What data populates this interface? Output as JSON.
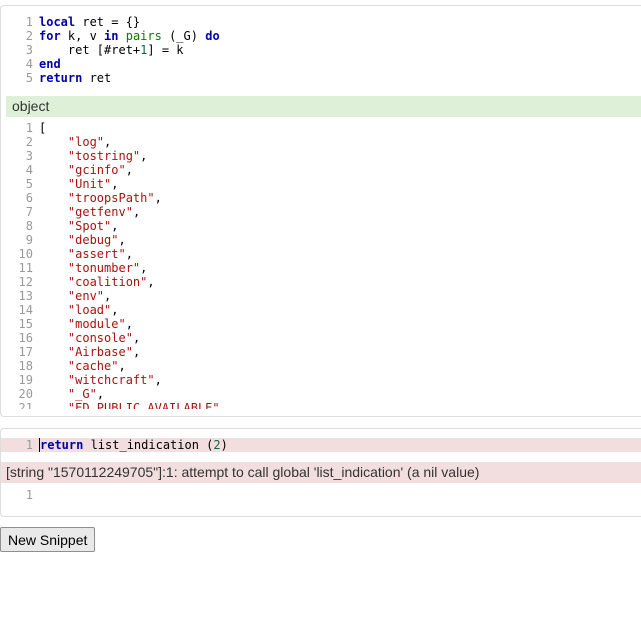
{
  "snippet1": {
    "input_lines": [
      {
        "n": "1",
        "tokens": [
          {
            "t": "local",
            "c": "kw"
          },
          {
            "t": " ret = {}"
          }
        ]
      },
      {
        "n": "2",
        "tokens": [
          {
            "t": "for",
            "c": "kw"
          },
          {
            "t": " k, v "
          },
          {
            "t": "in",
            "c": "kw"
          },
          {
            "t": " "
          },
          {
            "t": "pairs",
            "c": "bi"
          },
          {
            "t": " (_G) "
          },
          {
            "t": "do",
            "c": "kw"
          }
        ]
      },
      {
        "n": "3",
        "tokens": [
          {
            "t": "    ret [#ret+"
          },
          {
            "t": "1",
            "c": "num"
          },
          {
            "t": "] = k"
          }
        ]
      },
      {
        "n": "4",
        "tokens": [
          {
            "t": "end",
            "c": "kw"
          }
        ]
      },
      {
        "n": "5",
        "tokens": [
          {
            "t": "return",
            "c": "kw"
          },
          {
            "t": " ret"
          }
        ]
      }
    ],
    "output_type": "object",
    "output_lines": [
      {
        "n": "1",
        "text": "["
      },
      {
        "n": "2",
        "str": "\"log\""
      },
      {
        "n": "3",
        "str": "\"tostring\""
      },
      {
        "n": "4",
        "str": "\"gcinfo\""
      },
      {
        "n": "5",
        "str": "\"Unit\""
      },
      {
        "n": "6",
        "str": "\"troopsPath\""
      },
      {
        "n": "7",
        "str": "\"getfenv\""
      },
      {
        "n": "8",
        "str": "\"Spot\""
      },
      {
        "n": "9",
        "str": "\"debug\""
      },
      {
        "n": "10",
        "str": "\"assert\""
      },
      {
        "n": "11",
        "str": "\"tonumber\""
      },
      {
        "n": "12",
        "str": "\"coalition\""
      },
      {
        "n": "13",
        "str": "\"env\""
      },
      {
        "n": "14",
        "str": "\"load\""
      },
      {
        "n": "15",
        "str": "\"module\""
      },
      {
        "n": "16",
        "str": "\"console\""
      },
      {
        "n": "17",
        "str": "\"Airbase\""
      },
      {
        "n": "18",
        "str": "\"cache\""
      },
      {
        "n": "19",
        "str": "\"witchcraft\""
      },
      {
        "n": "20",
        "str": "\"_G\""
      },
      {
        "n": "21",
        "str": "\"ED_PUBLIC_AVAILABLE\""
      }
    ]
  },
  "snippet2": {
    "input_lines": [
      {
        "n": "1",
        "tokens": [
          {
            "t": "return",
            "c": "kw"
          },
          {
            "t": " list_indication ("
          },
          {
            "t": "2",
            "c": "num"
          },
          {
            "t": ")"
          }
        ]
      }
    ],
    "error_message": "[string \"1570112249705\"]:1: attempt to call global 'list_indication' (a nil value)",
    "new_input_lines": [
      {
        "n": "1"
      }
    ]
  },
  "new_snippet_label": "New Snippet"
}
